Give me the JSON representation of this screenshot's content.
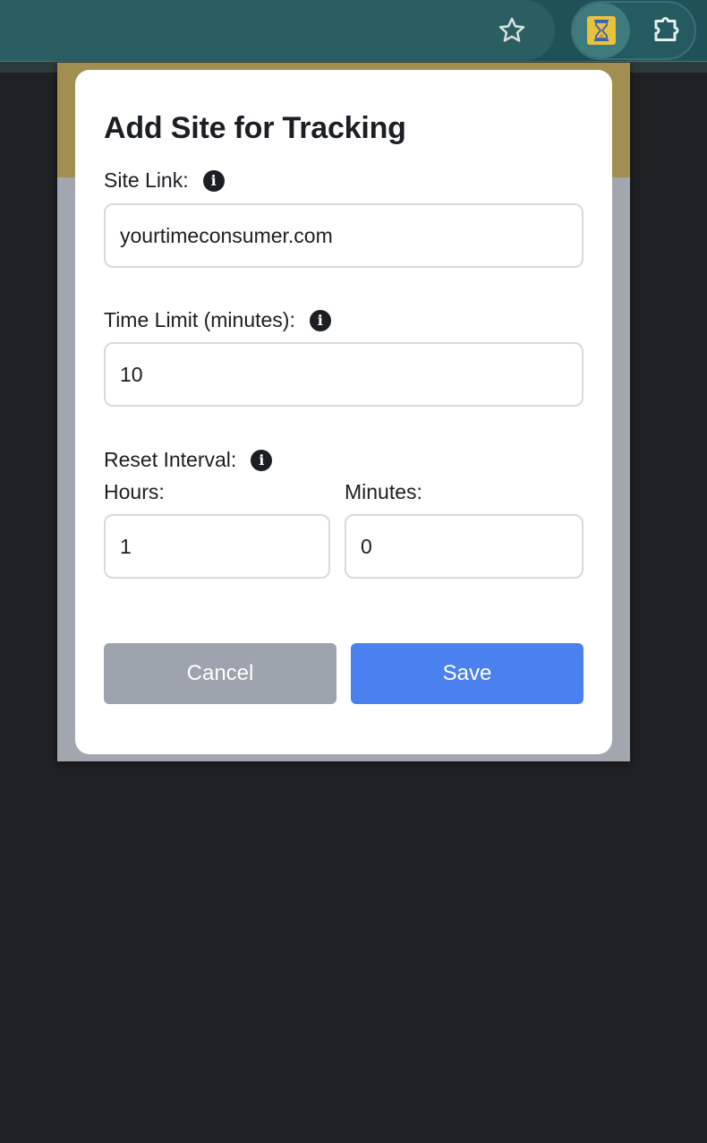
{
  "toolbar": {
    "bookmark_icon": "star-icon",
    "extension_icon": "hourglass-icon",
    "extensions_menu_icon": "puzzle-icon"
  },
  "dialog": {
    "title": "Add Site for Tracking",
    "site_link": {
      "label": "Site Link:",
      "value": "yourtimeconsumer.com"
    },
    "time_limit": {
      "label": "Time Limit (minutes):",
      "value": "10"
    },
    "reset_interval": {
      "label": "Reset Interval:",
      "hours_label": "Hours:",
      "hours_value": "1",
      "minutes_label": "Minutes:",
      "minutes_value": "0"
    },
    "cancel_label": "Cancel",
    "save_label": "Save"
  },
  "colors": {
    "toolbar": "#1f5257",
    "popup_header": "#a18f52",
    "cancel_button": "#9ea4ad",
    "save_button": "#4a81ee"
  }
}
